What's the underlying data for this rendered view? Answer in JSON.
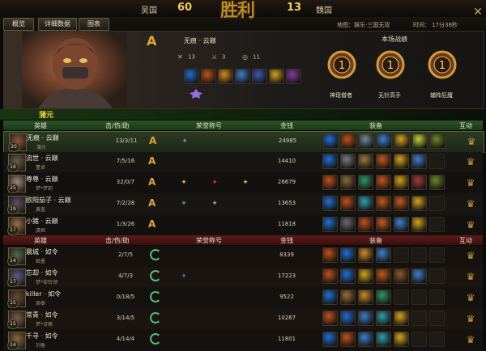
{
  "scoreboard": {
    "left_team": "吴国",
    "left_score": "60",
    "right_team": "魏国",
    "right_score": "13",
    "logo_text": "胜利"
  },
  "tabs": [
    "概览",
    "详细数据",
    "图表"
  ],
  "match_info": {
    "map": "地图：娱乐·三国无双",
    "time": "时间： 17分38秒"
  },
  "close_icon": "close-x",
  "hero_banner": {
    "rank": "A",
    "hero_title": "无痕 · 云巅",
    "stats": [
      {
        "icon": "swords-icon",
        "value": "13"
      },
      {
        "icon": "crossed-blades-icon",
        "value": "3"
      },
      {
        "icon": "ring-icon",
        "value": "11"
      }
    ],
    "equip_colors": [
      "#1f6fd6",
      "#c3501c",
      "#d68a1f",
      "#3c7fd0",
      "#4058b8",
      "#d4a21c",
      "#8a3aa8"
    ],
    "honor_color": "#9a6ee0",
    "record_title": "本场战绩",
    "medals": [
      {
        "label": "神现僧者",
        "number": "1"
      },
      {
        "label": "无针高手",
        "number": "1"
      },
      {
        "label": "辅阵狂魔",
        "number": "1"
      }
    ]
  },
  "player_name": "蒲元",
  "headers": {
    "hero": "英雄",
    "kda": "击/伤/助",
    "honor": "荣誉称号",
    "gold": "金钱",
    "equip": "装备",
    "interact": "互动"
  },
  "team_green": [
    {
      "name": "无痕 · 云巅",
      "hero": "蒲元",
      "level": "20",
      "kda": "13/3/11",
      "rank": "A",
      "gold": "24985",
      "avatar": "#8a5a3a",
      "honors": [
        "#9a6ee0"
      ],
      "equips": [
        "#1f6fd6",
        "#c3501c",
        "#6e8a9a",
        "#3c7fd0",
        "#d4a21c",
        "#c2cf3a",
        "#6a8a2a"
      ]
    },
    {
      "name": "流世 · 云巅",
      "hero": "董卓",
      "level": "16",
      "kda": "7/5/16",
      "rank": "A",
      "gold": "14410",
      "avatar": "#6a5e4e",
      "honors": [],
      "equips": [
        "#1f6fd6",
        "#7a7a86",
        "#9a7a3a",
        "#c7581e",
        "#d4a21c",
        "#3c7fd0"
      ]
    },
    {
      "name": "尊尊 · 云巅",
      "hero": "梦*梦莉",
      "level": "25",
      "kda": "32/0/7",
      "rank": "A",
      "gold": "26679",
      "avatar": "#a28a7a",
      "honors": [
        "#d4b02a",
        "#c83030",
        "#d0b060"
      ],
      "equips": [
        "#c3501c",
        "#8a6a3a",
        "#2c9a6a",
        "#c7581e",
        "#d4a21c",
        "#a23a3a",
        "#6a8a2a"
      ]
    },
    {
      "name": "欧阳茄子 · 云巅",
      "hero": "黄盖",
      "level": "19",
      "kda": "7/2/28",
      "rank": "A",
      "gold": "13653",
      "avatar": "#5a4e6a",
      "honors": [
        "#4aa04a",
        "#8aa0b0"
      ],
      "equips": [
        "#1f6fd6",
        "#c3501c",
        "#2ca0b0",
        "#c7581e",
        "#c7581e",
        "#d4a21c"
      ]
    },
    {
      "name": "小猪 · 云巅",
      "hero": "虞姬",
      "level": "17",
      "kda": "1/3/26",
      "rank": "A",
      "gold": "11818",
      "avatar": "#9a6e4a",
      "honors": [],
      "equips": [
        "#1f6fd6",
        "#6a6a7a",
        "#c3501c",
        "#c7581e",
        "#3c7fd0",
        "#d4a21c"
      ]
    }
  ],
  "team_red": [
    {
      "name": "晨城 · 如令",
      "hero": "姬墨",
      "level": "14",
      "kda": "2/7/5",
      "rank": "C",
      "gold": "8339",
      "avatar": "#4e6a4a",
      "honors": [],
      "equips": [
        "#c3501c",
        "#1f6fd6",
        "#d08a2a",
        "#3c7fd0"
      ]
    },
    {
      "name": "忘却 · 如令",
      "hero": "梦*拾铃领",
      "level": "17",
      "kda": "4/7/3",
      "rank": "C",
      "gold": "17223",
      "avatar": "#5a5a8a",
      "honors": [
        "#3a6ab0"
      ],
      "equips": [
        "#c3501c",
        "#1f6fd6",
        "#d4a21c",
        "#c7581e",
        "#8a5a2a",
        "#3c7fd0"
      ]
    },
    {
      "name": "killer · 如令",
      "hero": "周泰",
      "level": "15",
      "kda": "0/18/5",
      "rank": "C",
      "gold": "9522",
      "avatar": "#6a4a3a",
      "honors": [],
      "equips": [
        "#1f6fd6",
        "#9a6a3a",
        "#d08a2a",
        "#2c9a6a"
      ]
    },
    {
      "name": "常青 · 如令",
      "hero": "梦*诗楠",
      "level": "15",
      "kda": "3/14/5",
      "rank": "C",
      "gold": "10267",
      "avatar": "#7a5a4a",
      "honors": [],
      "equips": [
        "#c3501c",
        "#1f6fd6",
        "#3c7fd0",
        "#2ca0b0",
        "#d4a21c"
      ]
    },
    {
      "name": "千寻 · 如令",
      "hero": "刘备",
      "level": "14",
      "kda": "4/14/4",
      "rank": "C",
      "gold": "11801",
      "avatar": "#8a6a3a",
      "honors": [],
      "equips": [
        "#1f6fd6",
        "#c3501c",
        "#3c7fd0",
        "#2ca0b0",
        "#d4a21c"
      ]
    }
  ]
}
